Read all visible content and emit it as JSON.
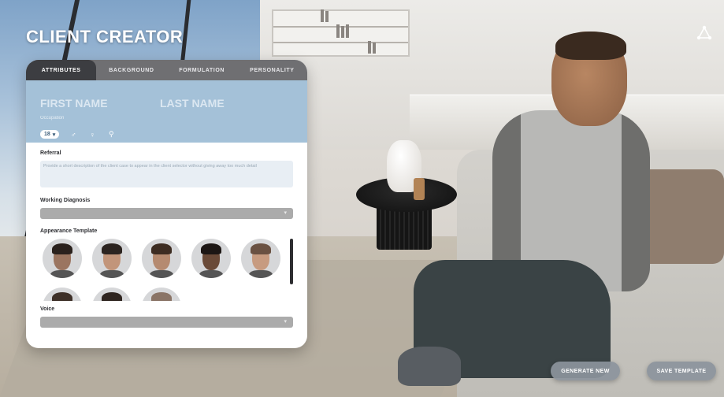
{
  "app": {
    "title": "CLIENT CREATOR",
    "logo_icon": "triangle-nodes-icon"
  },
  "tabs": [
    {
      "label": "ATTRIBUTES",
      "active": true
    },
    {
      "label": "BACKGROUND",
      "active": false
    },
    {
      "label": "FORMULATION",
      "active": false
    },
    {
      "label": "PERSONALITY",
      "active": false
    }
  ],
  "identity": {
    "first_name_placeholder": "FIRST NAME",
    "last_name_placeholder": "LAST NAME",
    "occupation_placeholder": "Occupation",
    "age_value": "18",
    "gender_icons": [
      "male-icon",
      "female-icon",
      "nonbinary-icon"
    ],
    "gender_glyphs": [
      "♂",
      "♀",
      "⚲"
    ]
  },
  "referral": {
    "label": "Referral",
    "placeholder": "Provide a short description of the client case to appear in the client selector without giving away too much detail"
  },
  "working_diagnosis": {
    "label": "Working Diagnosis",
    "value": ""
  },
  "appearance": {
    "label": "Appearance Template",
    "avatars": [
      {
        "skin": "#9b7560",
        "hair": "#2a211d"
      },
      {
        "skin": "#c2957a",
        "hair": "#2c2420"
      },
      {
        "skin": "#b58a70",
        "hair": "#3d2c22"
      },
      {
        "skin": "#6a4a38",
        "hair": "#1c1614"
      },
      {
        "skin": "#c79b80",
        "hair": "#6a5142"
      },
      {
        "skin": "#b98d74",
        "hair": "#3e3028"
      },
      {
        "skin": "#c9a087",
        "hair": "#2f2520"
      },
      {
        "skin": "#d7b19a",
        "hair": "#8a7466"
      }
    ]
  },
  "voice": {
    "label": "Voice",
    "value": ""
  },
  "actions": {
    "generate_label": "GENERATE NEW",
    "save_label": "SAVE TEMPLATE"
  }
}
